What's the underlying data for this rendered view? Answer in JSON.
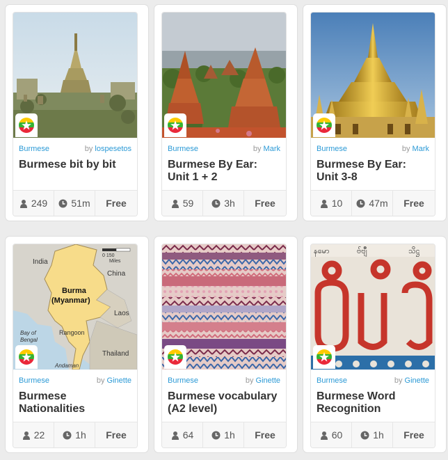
{
  "courses": [
    {
      "language": "Burmese",
      "by": "by",
      "author": "lospesetos",
      "title": "Burmese bit by bit",
      "learners": "249",
      "time": "51m",
      "price": "Free",
      "image_icon": "pagoda-mist-image"
    },
    {
      "language": "Burmese",
      "by": "by",
      "author": "Mark",
      "title": "Burmese By Ear: Unit 1 + 2",
      "learners": "59",
      "time": "3h",
      "price": "Free",
      "image_icon": "bagan-temples-image"
    },
    {
      "language": "Burmese",
      "by": "by",
      "author": "Mark",
      "title": "Burmese By Ear: Unit 3-8",
      "learners": "10",
      "time": "47m",
      "price": "Free",
      "image_icon": "golden-pagoda-image"
    },
    {
      "language": "Burmese",
      "by": "by",
      "author": "Ginette",
      "title": "Burmese Nationalities",
      "learners": "22",
      "time": "1h",
      "price": "Free",
      "image_icon": "burma-map-image"
    },
    {
      "language": "Burmese",
      "by": "by",
      "author": "Ginette",
      "title": "Burmese vocabulary (A2 level)",
      "learners": "64",
      "time": "1h",
      "price": "Free",
      "image_icon": "textile-pattern-image"
    },
    {
      "language": "Burmese",
      "by": "by",
      "author": "Ginette",
      "title": "Burmese Word Recognition",
      "learners": "60",
      "time": "1h",
      "price": "Free",
      "image_icon": "burmese-script-image"
    }
  ],
  "map_labels": {
    "india": "India",
    "china": "China",
    "burma": "Burma",
    "myanmar": "(Myanmar)",
    "laos": "Laos",
    "rangoon": "Rangoon",
    "bay": "Bay of",
    "bengal": "Bengal",
    "thailand": "Thailand",
    "andaman": "Andaman",
    "scale": "0    150",
    "miles": "Miles"
  },
  "script_labels": {
    "top_left": "နမော",
    "top_mid": "ဗ်ဗျဳ",
    "top_right": "သိဋ္ဌ"
  },
  "colors": {
    "accent": "#2c9ad6",
    "flag_yellow": "#FECB00",
    "flag_green": "#34B233",
    "flag_red": "#EA2839"
  }
}
